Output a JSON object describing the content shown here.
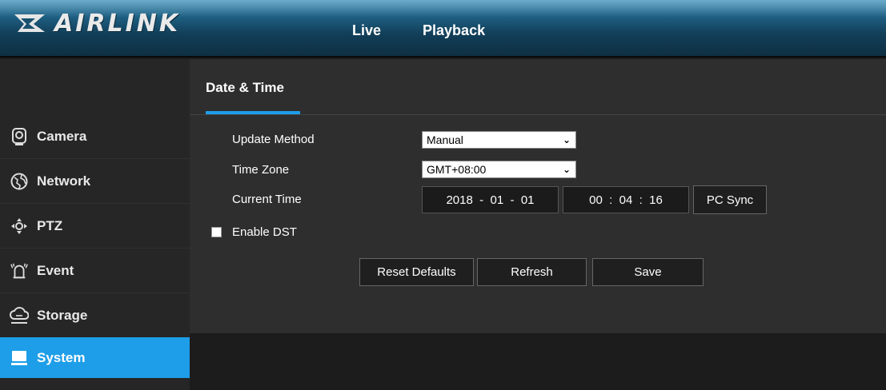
{
  "header": {
    "logo_text": "AIRLINK",
    "nav": [
      {
        "label": "Live"
      },
      {
        "label": "Playback"
      }
    ]
  },
  "sidebar": {
    "items": [
      {
        "label": "Camera",
        "icon": "camera-icon"
      },
      {
        "label": "Network",
        "icon": "network-globe-icon"
      },
      {
        "label": "PTZ",
        "icon": "ptz-directional-icon"
      },
      {
        "label": "Event",
        "icon": "alarm-bell-icon"
      },
      {
        "label": "Storage",
        "icon": "cloud-storage-icon"
      },
      {
        "label": "System",
        "icon": "monitor-icon",
        "active": true
      }
    ]
  },
  "main": {
    "tab": "Date & Time",
    "update_method": {
      "label": "Update Method",
      "value": "Manual"
    },
    "time_zone": {
      "label": "Time Zone",
      "value": "GMT+08:00"
    },
    "current_time": {
      "label": "Current Time",
      "date": "2018  -  01  -  01",
      "time": "00  :  04  :  16",
      "sync_label": "PC Sync"
    },
    "dst": {
      "label": "Enable DST",
      "checked": false
    },
    "buttons": {
      "reset": "Reset Defaults",
      "refresh": "Refresh",
      "save": "Save"
    }
  },
  "colors": {
    "accent": "#1e9ee8",
    "panel": "#2e2e2e",
    "sidebar": "#262626",
    "header_top": "#3b8fb8",
    "header_bottom": "#0e2f42"
  }
}
